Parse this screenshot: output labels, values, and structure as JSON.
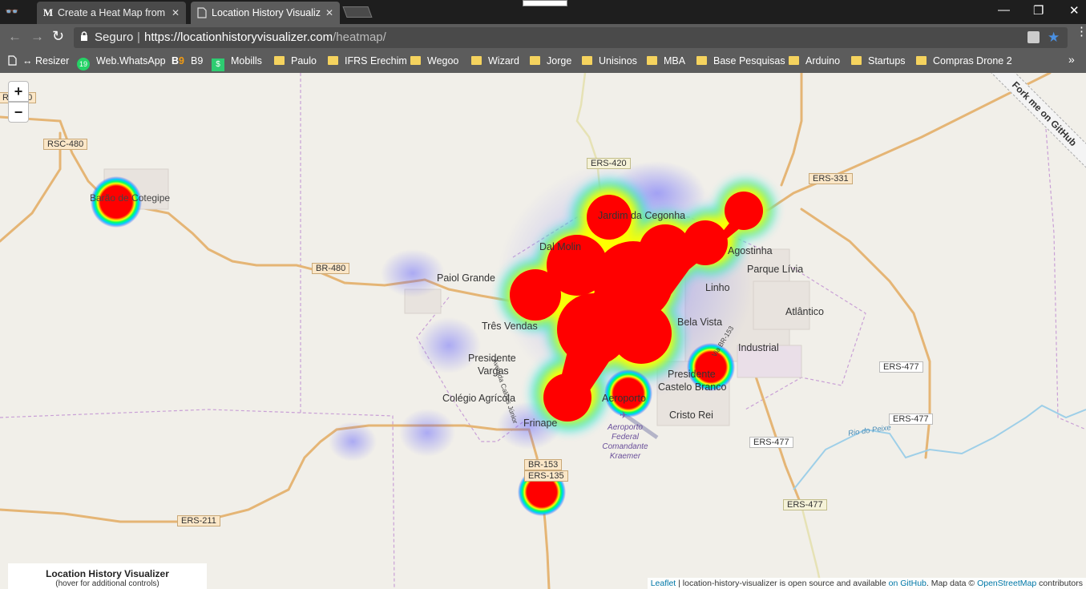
{
  "tabs": [
    {
      "favicon": "M",
      "title": "Create a Heat Map from"
    },
    {
      "favicon": "page-icon",
      "title": "Location History Visualiz"
    }
  ],
  "omnibox": {
    "secure_label": "Seguro",
    "url_host": "https://locationhistoryvisualizer.com",
    "url_path": "/heatmap/"
  },
  "bookmarks": [
    {
      "label": "↔ Resizer",
      "icon": "page-icon"
    },
    {
      "label": "Web.WhatsApp",
      "icon": "whatsapp-icon",
      "badge": "19"
    },
    {
      "label": "B9",
      "icon": "b9-icon"
    },
    {
      "label": "Mobills",
      "icon": "mobills-icon"
    },
    {
      "label": "Paulo",
      "icon": "folder-icon"
    },
    {
      "label": "IFRS Erechim",
      "icon": "folder-icon"
    },
    {
      "label": "Wegoo",
      "icon": "folder-icon"
    },
    {
      "label": "Wizard",
      "icon": "folder-icon"
    },
    {
      "label": "Jorge",
      "icon": "folder-icon"
    },
    {
      "label": "Unisinos",
      "icon": "folder-icon"
    },
    {
      "label": "MBA",
      "icon": "folder-icon"
    },
    {
      "label": "Base Pesquisas",
      "icon": "folder-icon"
    },
    {
      "label": "Arduino",
      "icon": "folder-icon"
    },
    {
      "label": "Startups",
      "icon": "folder-icon"
    },
    {
      "label": "Compras Drone 2",
      "icon": "folder-icon"
    }
  ],
  "map": {
    "zoom_in": "+",
    "zoom_out": "−",
    "fork_ribbon": "Fork me on GitHub",
    "road_labels": [
      "RSC-480",
      "BR-480",
      "ERS-420",
      "ERS-331",
      "ERS-477",
      "ERS-477",
      "ERS-477",
      "ERS-477",
      "BR-153",
      "ERS-135",
      "ERS-211",
      "RS-480"
    ],
    "place_labels": [
      "Barão de Cotegipe",
      "Paiol Grande",
      "Dal Molin",
      "Três Vendas",
      "Presidente",
      "Vargas",
      "Colégio Agrícola",
      "Frinape",
      "Bela Vista",
      "Industrial",
      "Linho",
      "Parque Lívia",
      "Atlântico",
      "Castelo Branco",
      "Cristo Rei",
      "Presidente",
      "Aeroporto",
      "Jardim da Cegonha",
      "Agostinha",
      "Rio do Peixe",
      "Avenida Caldas Júnior",
      "Via BR-153"
    ],
    "airport_label": [
      "Aeroporto",
      "Federal",
      "Comandante",
      "Kraemer"
    ],
    "attribution": {
      "leaflet": "Leaflet",
      "text1": " | location-history-visualizer is open source and available ",
      "github": "on GitHub",
      "text2": ". Map data © ",
      "osm": "OpenStreetMap",
      "text3": " contributors"
    },
    "info_title": "Location History Visualizer",
    "info_sub": "(hover for additional controls)"
  }
}
